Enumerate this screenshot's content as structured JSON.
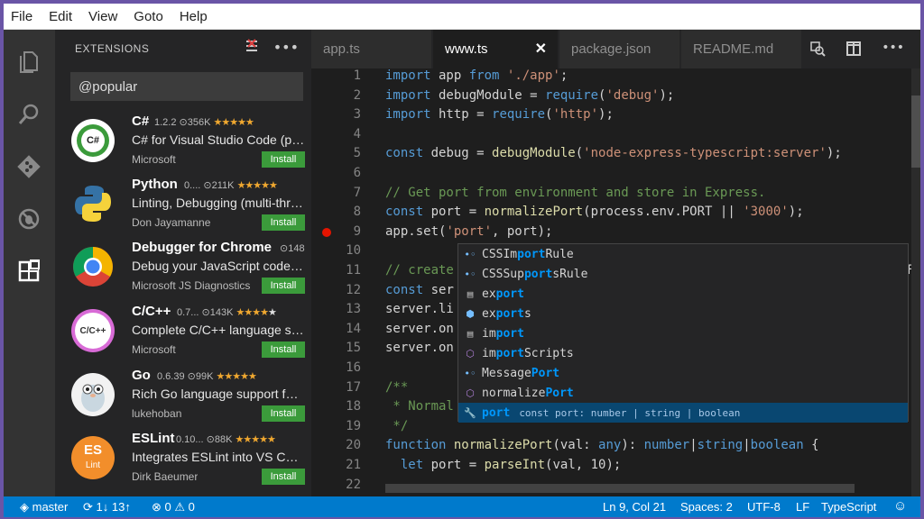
{
  "menu": [
    "File",
    "Edit",
    "View",
    "Goto",
    "Help"
  ],
  "sidebar": {
    "title": "EXTENSIONS",
    "search_value": "@popular",
    "extensions": [
      {
        "name": "C#",
        "version": "1.2.2",
        "downloads": "356K",
        "rating": 4.5,
        "description": "C# for Visual Studio Code (powered by OmniSharp)",
        "publisher": "Microsoft",
        "install": "Install",
        "logo": "C#"
      },
      {
        "name": "Python",
        "version": "0....",
        "downloads": "211K",
        "rating": 4.5,
        "description": "Linting, Debugging (multi-threaded)",
        "publisher": "Don Jayamanne",
        "install": "Install",
        "logo": ""
      },
      {
        "name": "Debugger for Chrome",
        "version": "",
        "downloads": "148",
        "rating": 0,
        "description": "Debug your JavaScript code in Chrome",
        "publisher": "Microsoft JS Diagnostics",
        "install": "Install",
        "logo": ""
      },
      {
        "name": "C/C++",
        "version": "0.7...",
        "downloads": "143K",
        "rating": 3.5,
        "description": "Complete C/C++ language support",
        "publisher": "Microsoft",
        "install": "Install",
        "logo": "C/C++"
      },
      {
        "name": "Go",
        "version": "0.6.39",
        "downloads": "99K",
        "rating": 4.5,
        "description": "Rich Go language support for Visual Studio Code",
        "publisher": "lukehoban",
        "install": "Install",
        "logo": ""
      },
      {
        "name": "ESLint",
        "version": "0.10...",
        "downloads": "88K",
        "rating": 4.5,
        "description": "Integrates ESLint into VS Code.",
        "publisher": "Dirk Baeumer",
        "install": "Install",
        "logo": "ES"
      }
    ]
  },
  "tabs": [
    {
      "label": "app.ts",
      "active": false
    },
    {
      "label": "www.ts",
      "active": true
    },
    {
      "label": "package.json",
      "active": false
    },
    {
      "label": "README.md",
      "active": false
    }
  ],
  "line_numbers": [
    "1",
    "2",
    "3",
    "4",
    "5",
    "6",
    "7",
    "8",
    "9",
    "10",
    "11",
    "12",
    "13",
    "14",
    "15",
    "16",
    "17",
    "18",
    "19",
    "20",
    "21",
    "22"
  ],
  "code_lines": [
    "import app from './app';",
    "import debugModule = require('debug');",
    "import http = require('http');",
    "",
    "const debug = debugModule('node-express-typescript:server');",
    "",
    "// Get port from environment and store in Express.",
    "const port = normalizePort(process.env.PORT || '3000');",
    "app.set('port', port);",
    "",
    "// create",
    "const ser",
    "server.li",
    "server.on",
    "server.on",
    "",
    "/**",
    " * Normal",
    " */",
    "function normalizePort(val: any): number|string|boolean {",
    "  let port = parseInt(val, 10);",
    ""
  ],
  "line11_tail": "Fac",
  "suggestions": [
    {
      "pre": "CSSIm",
      "hl": "port",
      "post": "Rule",
      "kind": "interface",
      "detail": ""
    },
    {
      "pre": "CSSSup",
      "hl": "port",
      "post": "sRule",
      "kind": "interface",
      "detail": ""
    },
    {
      "pre": "ex",
      "hl": "port",
      "post": "",
      "kind": "keyword",
      "detail": ""
    },
    {
      "pre": "ex",
      "hl": "port",
      "post": "s",
      "kind": "module",
      "detail": ""
    },
    {
      "pre": "im",
      "hl": "port",
      "post": "",
      "kind": "keyword",
      "detail": ""
    },
    {
      "pre": "im",
      "hl": "port",
      "post": "Scripts",
      "kind": "function",
      "detail": ""
    },
    {
      "pre": "Message",
      "hl": "Port",
      "post": "",
      "kind": "interface",
      "detail": ""
    },
    {
      "pre": "normalize",
      "hl": "Port",
      "post": "",
      "kind": "function",
      "detail": ""
    },
    {
      "pre": "",
      "hl": "port",
      "post": "",
      "kind": "variable",
      "detail": "const port: number | string | boolean"
    }
  ],
  "status": {
    "branch": "master",
    "sync": "1↓ 13↑",
    "errors": "0",
    "warnings": "0",
    "position": "Ln 9, Col 21",
    "spaces": "Spaces: 2",
    "encoding": "UTF-8",
    "eol": "LF",
    "language": "TypeScript"
  },
  "colors": {
    "accent": "#007acc",
    "install": "#3b9b3b",
    "keyword": "#569cd6",
    "string": "#ce9178",
    "comment": "#6a9955",
    "breakpoint": "#e51400"
  },
  "icons": [
    "files-icon",
    "search-icon",
    "git-icon",
    "debug-icon",
    "extensions-icon",
    "clear-icon",
    "more-icon",
    "close-icon",
    "split-icon",
    "smiley-icon"
  ]
}
